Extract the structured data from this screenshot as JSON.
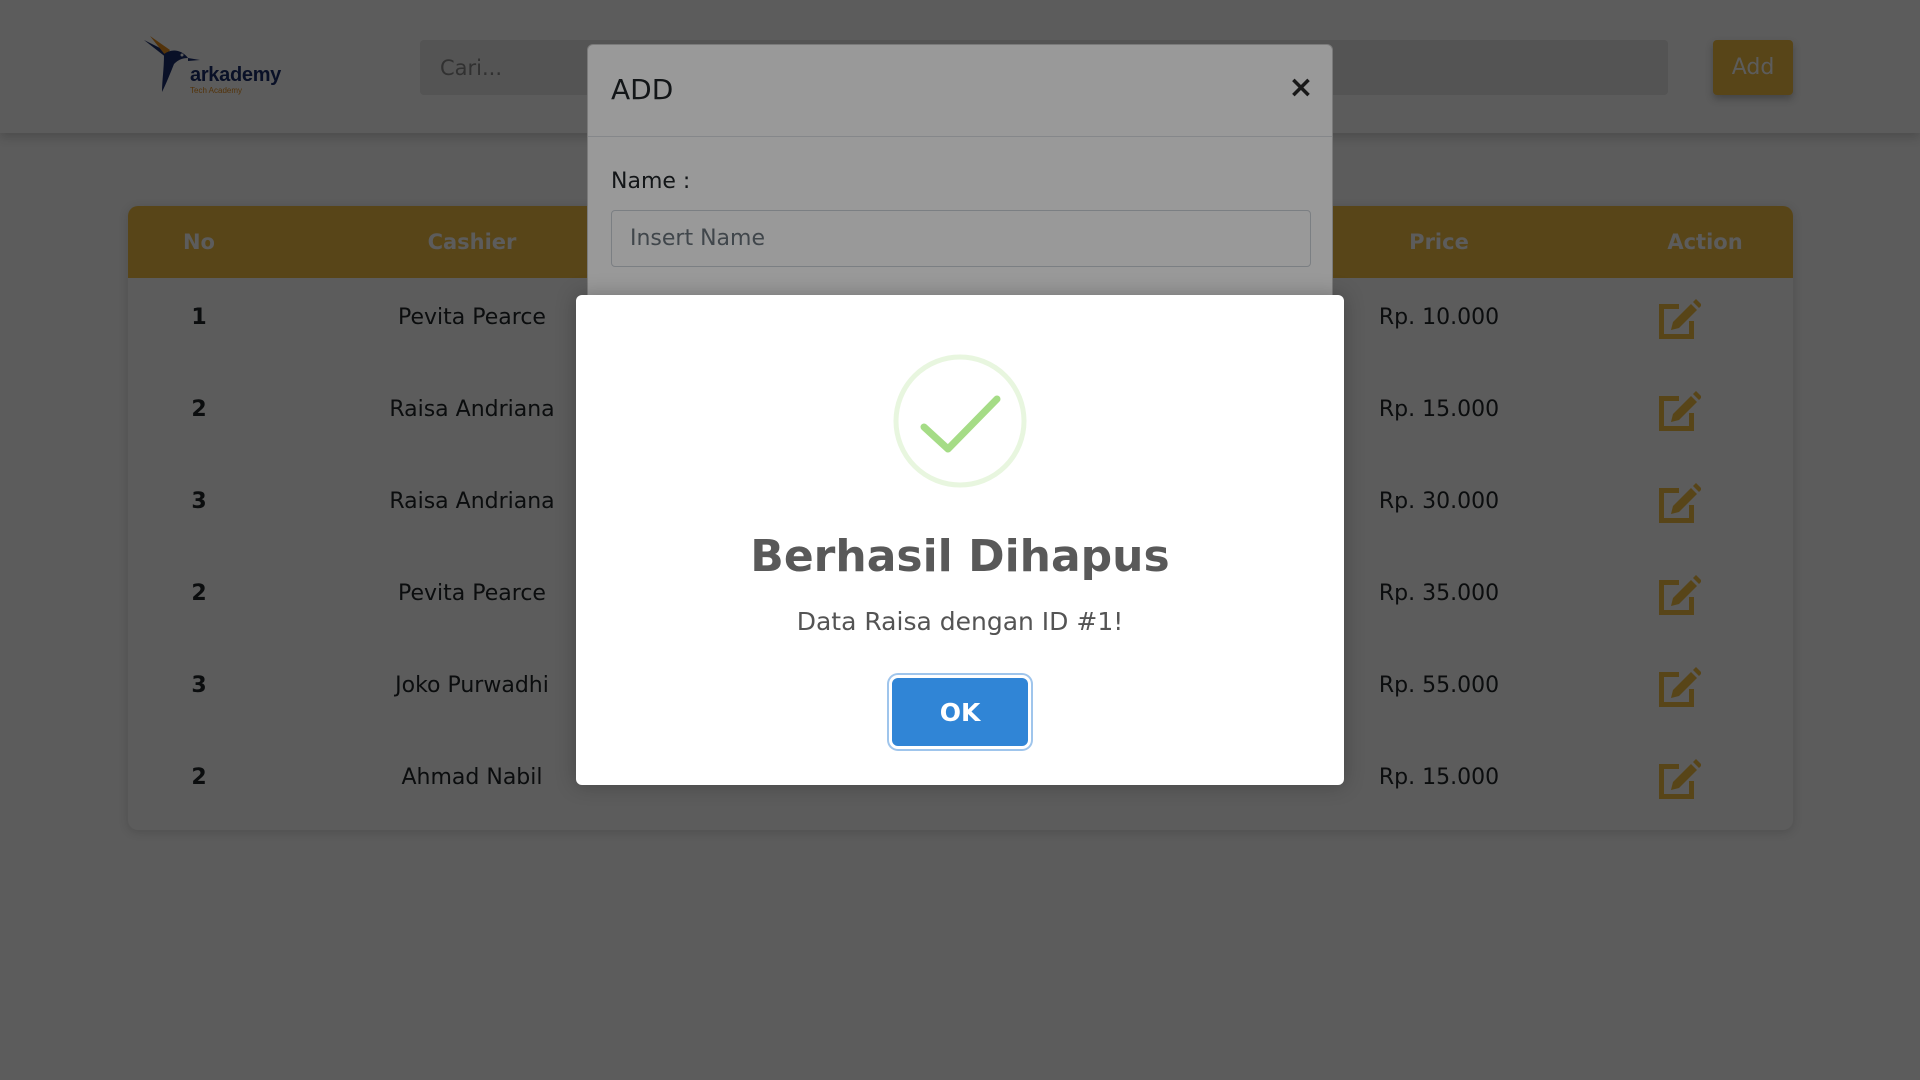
{
  "header": {
    "logo_text": "arkademy",
    "logo_subtext": "Tech Academy",
    "search_placeholder": "Cari...",
    "add_label": "Add"
  },
  "table": {
    "columns": [
      "No",
      "Cashier",
      "Price",
      "Action"
    ],
    "rows": [
      {
        "no": "1",
        "cashier": "Pevita Pearce",
        "price": "Rp. 10.000"
      },
      {
        "no": "2",
        "cashier": "Raisa Andriana",
        "price": "Rp. 15.000"
      },
      {
        "no": "3",
        "cashier": "Raisa Andriana",
        "price": "Rp. 30.000"
      },
      {
        "no": "2",
        "cashier": "Pevita Pearce",
        "price": "Rp. 35.000"
      },
      {
        "no": "3",
        "cashier": "Joko Purwadhi",
        "price": "Rp. 55.000"
      },
      {
        "no": "2",
        "cashier": "Ahmad Nabil",
        "price": "Rp. 15.000"
      }
    ]
  },
  "add_modal": {
    "title": "ADD",
    "close_label": "×",
    "name_label": "Name :",
    "name_placeholder": "Insert Name"
  },
  "alert": {
    "icon": "success-check-icon",
    "title": "Berhasil Dihapus",
    "text": "Data Raisa dengan ID #1!",
    "ok_label": "OK"
  },
  "colors": {
    "accent": "#f6c043",
    "confirm": "#3085d6",
    "success": "#a5dc86"
  }
}
